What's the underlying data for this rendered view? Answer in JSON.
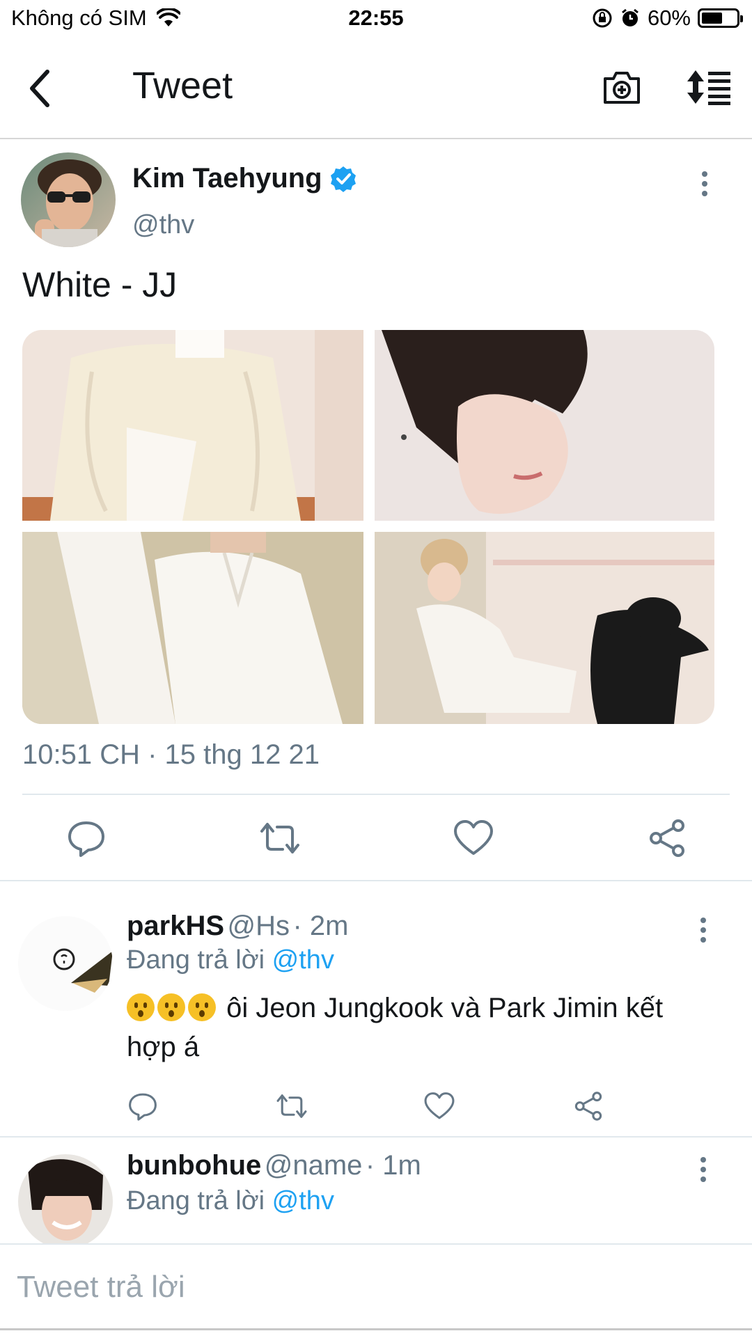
{
  "status_bar": {
    "carrier": "Không có SIM",
    "time": "22:55",
    "battery_percent": "60%",
    "battery_level": 0.6
  },
  "header": {
    "title": "Tweet",
    "back_icon": "chevron-left-icon",
    "camera_icon": "camera-plus-icon",
    "sort_icon": "sort-list-icon"
  },
  "tweet": {
    "author_name": "Kim Taehyung",
    "author_handle": "@thv",
    "verified": true,
    "text": "White - JJ",
    "timestamp": "10:51 CH · 15 thg 12 21",
    "media_count": 4
  },
  "actions": [
    "reply-icon",
    "retweet-icon",
    "like-icon",
    "share-icon"
  ],
  "replies": [
    {
      "name": "parkHS",
      "handle": "@Hs",
      "time": "· 2m",
      "replying_prefix": "Đang trả lời",
      "replying_to": "@thv",
      "emoji_count": 3,
      "text": "ôi Jeon Jungkook và Park Jimin kết hợp á"
    },
    {
      "name": "bunbohue",
      "handle": "@name",
      "time": "· 1m",
      "replying_prefix": "Đang trả lời",
      "replying_to": "@thv"
    }
  ],
  "composer": {
    "placeholder": "Tweet trả lời"
  },
  "colors": {
    "accent": "#1da1f2",
    "text": "#14171a",
    "secondary": "#657786",
    "divider": "#e1e8ed"
  }
}
